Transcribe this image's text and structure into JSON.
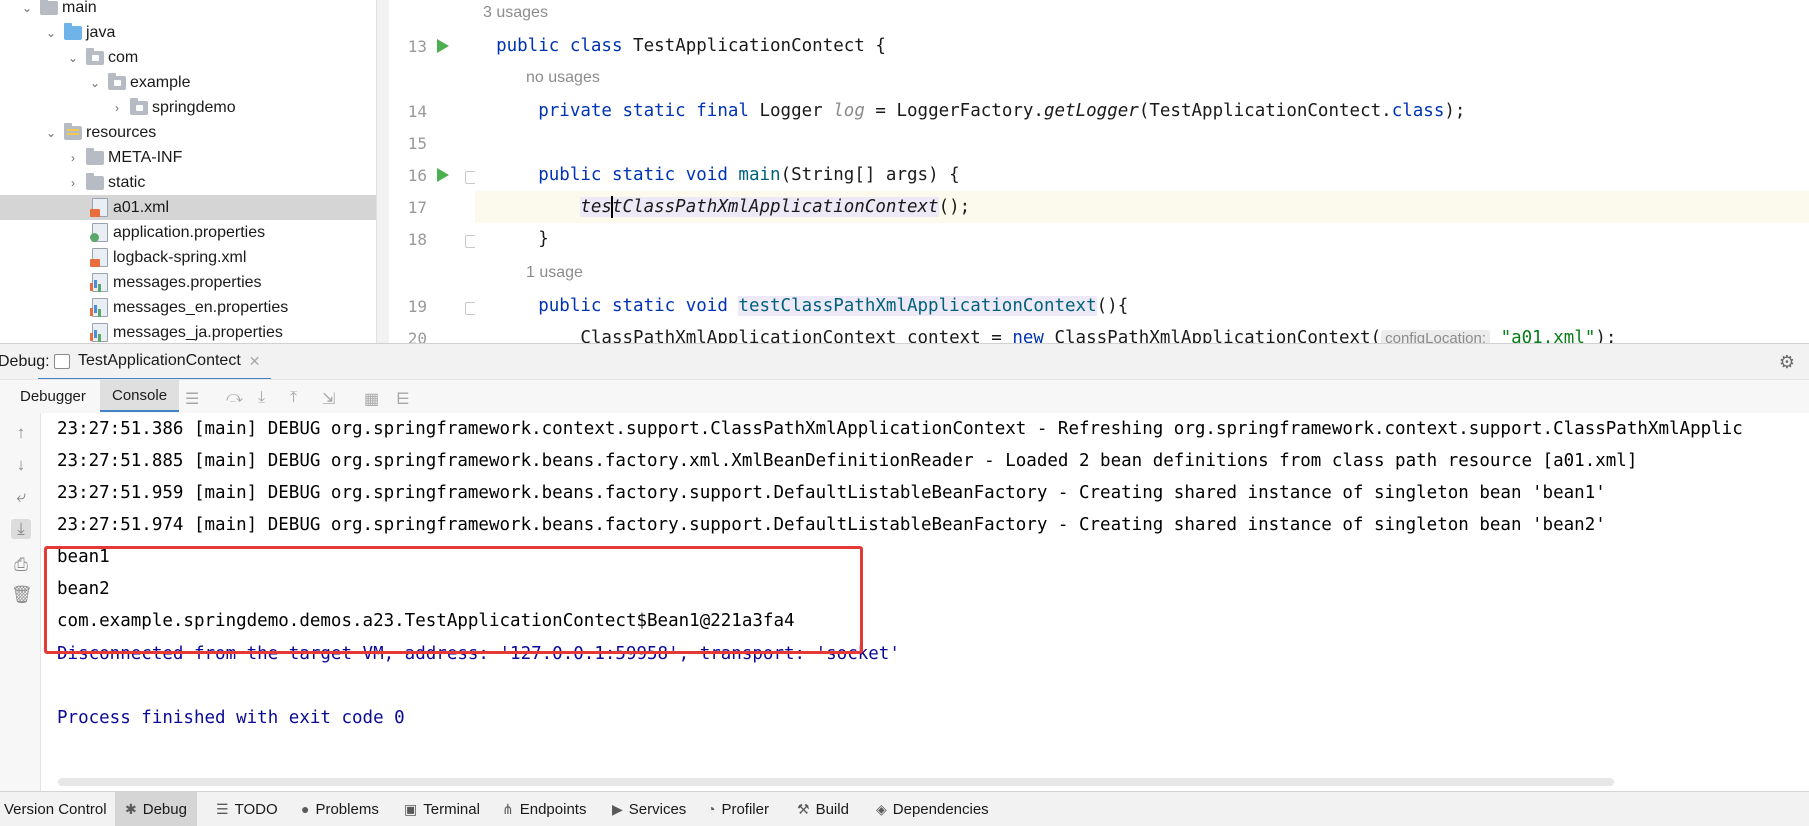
{
  "project_tree": [
    {
      "label": "main",
      "indent": 0,
      "chevron": "down",
      "icon": "folder"
    },
    {
      "label": "java",
      "indent": 1,
      "chevron": "down",
      "icon": "folder-blue"
    },
    {
      "label": "com",
      "indent": 2,
      "chevron": "down",
      "icon": "package"
    },
    {
      "label": "example",
      "indent": 3,
      "chevron": "down",
      "icon": "package"
    },
    {
      "label": "springdemo",
      "indent": 4,
      "chevron": "right",
      "icon": "package"
    },
    {
      "label": "resources",
      "indent": 1,
      "chevron": "down",
      "icon": "resources-folder"
    },
    {
      "label": "META-INF",
      "indent": 2,
      "chevron": "right",
      "icon": "folder"
    },
    {
      "label": "static",
      "indent": 2,
      "chevron": "right",
      "icon": "folder"
    },
    {
      "label": "a01.xml",
      "indent": 3,
      "chevron": "",
      "icon": "xml-file",
      "selected": true
    },
    {
      "label": "application.properties",
      "indent": 3,
      "chevron": "",
      "icon": "properties-file"
    },
    {
      "label": "logback-spring.xml",
      "indent": 3,
      "chevron": "",
      "icon": "xml-file"
    },
    {
      "label": "messages.properties",
      "indent": 3,
      "chevron": "",
      "icon": "messages-file"
    },
    {
      "label": "messages_en.properties",
      "indent": 3,
      "chevron": "",
      "icon": "messages-file"
    },
    {
      "label": "messages_ja.properties",
      "indent": 3,
      "chevron": "",
      "icon": "messages-file"
    }
  ],
  "editor": {
    "hint_3_usages": "3 usages",
    "hint_no_usages": "no usages",
    "hint_1_usage": "1 usage",
    "line_numbers": [
      "13",
      "14",
      "15",
      "16",
      "17",
      "18",
      "19",
      "20"
    ],
    "l13": {
      "kw": "public class ",
      "name": "TestApplicationContect",
      " rest": " {"
    },
    "l14": {
      "kw": "private static final ",
      "type": "Logger ",
      "var": "log",
      " eq": " = LoggerFactory.",
      "method": "getLogger",
      "args": "(TestApplicationContect.",
      "cls": "class",
      "end": ");"
    },
    "l16": {
      "kw": "public static void ",
      "name": "main",
      "rest": "(String[] args) {"
    },
    "l17": {
      "before_caret": "tes",
      "after_caret": "tClassPathXmlApplicationContext",
      "rest": "();"
    },
    "l18": {
      "text": "}"
    },
    "l19": {
      "kw": "public static void ",
      "name": "testClassPathXmlApplicationContext",
      "rest": "(){"
    },
    "l20": {
      "text": "ClassPathXmlApplicationContext context = ",
      "kw": "new",
      "rest": " ClassPathXmlApplicationContext(",
      "hint": "configLocation:",
      "str": "\"a01.xml\"",
      "end": ");"
    }
  },
  "debug": {
    "label": "Debug:",
    "run_config_tab": "TestApplicationContect",
    "tabs": [
      "Debugger",
      "Console"
    ],
    "active_tab": "Console"
  },
  "console": {
    "lines": [
      {
        "text": "23:27:51.386 [main] DEBUG org.springframework.context.support.ClassPathXmlApplicationContext - Refreshing org.springframework.context.support.ClassPathXmlApplic",
        "style": "normal"
      },
      {
        "text": "23:27:51.885 [main] DEBUG org.springframework.beans.factory.xml.XmlBeanDefinitionReader - Loaded 2 bean definitions from class path resource [a01.xml]",
        "style": "normal"
      },
      {
        "text": "23:27:51.959 [main] DEBUG org.springframework.beans.factory.support.DefaultListableBeanFactory - Creating shared instance of singleton bean 'bean1'",
        "style": "normal"
      },
      {
        "text": "23:27:51.974 [main] DEBUG org.springframework.beans.factory.support.DefaultListableBeanFactory - Creating shared instance of singleton bean 'bean2'",
        "style": "normal"
      },
      {
        "text": "bean1",
        "style": "normal"
      },
      {
        "text": "bean2",
        "style": "normal"
      },
      {
        "text": "com.example.springdemo.demos.a23.TestApplicationContect$Bean1@221a3fa4",
        "style": "normal"
      },
      {
        "text": "Disconnected from the target VM, address: '127.0.0.1:59958', transport: 'socket'",
        "style": "blue"
      },
      {
        "text": "",
        "style": "normal"
      },
      {
        "text": "Process finished with exit code 0",
        "style": "blue"
      }
    ]
  },
  "bottom_bar": [
    {
      "label": "Version Control",
      "icon": "",
      "active": false
    },
    {
      "label": "Debug",
      "icon": "bug-icon",
      "active": true
    },
    {
      "label": "TODO",
      "icon": "list-icon",
      "active": false
    },
    {
      "label": "Problems",
      "icon": "problems-icon",
      "active": false
    },
    {
      "label": "Terminal",
      "icon": "terminal-icon",
      "active": false
    },
    {
      "label": "Endpoints",
      "icon": "endpoints-icon",
      "active": false
    },
    {
      "label": "Services",
      "icon": "services-icon",
      "active": false
    },
    {
      "label": "Profiler",
      "icon": "profiler-icon",
      "active": false
    },
    {
      "label": "Build",
      "icon": "hammer-icon",
      "active": false
    },
    {
      "label": "Dependencies",
      "icon": "dependencies-icon",
      "active": false
    }
  ],
  "colors": {
    "accent": "#4083c9",
    "highlight_box": "#e53935",
    "run_green": "#4caf50",
    "console_blue": "#0a0a96",
    "keyword": "#0033b3",
    "string": "#067d17"
  }
}
